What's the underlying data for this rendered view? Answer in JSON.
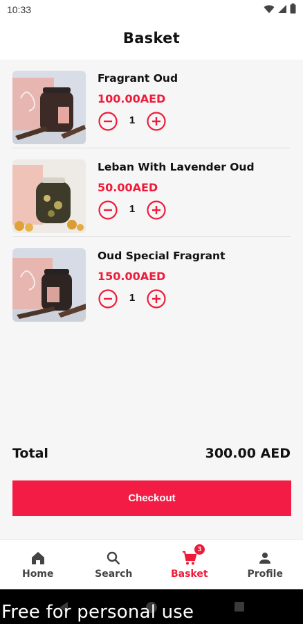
{
  "status_bar": {
    "time": "10:33"
  },
  "header": {
    "title": "Basket"
  },
  "cart": {
    "items": [
      {
        "name": "Fragrant Oud",
        "price": "100.00AED",
        "quantity": "1"
      },
      {
        "name": "Leban With Lavender Oud",
        "price": "50.00AED",
        "quantity": "1"
      },
      {
        "name": "Oud Special Fragrant",
        "price": "150.00AED",
        "quantity": "1"
      }
    ]
  },
  "summary": {
    "total_label": "Total",
    "total_value": "300.00 AED"
  },
  "checkout": {
    "label": "Checkout"
  },
  "nav": {
    "items": [
      {
        "label": "Home",
        "icon": "home-icon"
      },
      {
        "label": "Search",
        "icon": "search-icon"
      },
      {
        "label": "Basket",
        "icon": "cart-icon",
        "badge": "3"
      },
      {
        "label": "Profile",
        "icon": "person-icon"
      }
    ],
    "active": "Basket"
  },
  "watermark": "Free for personal use",
  "colors": {
    "accent": "#ee1c3a",
    "button": "#f31c44",
    "background": "#f6f6f6"
  }
}
